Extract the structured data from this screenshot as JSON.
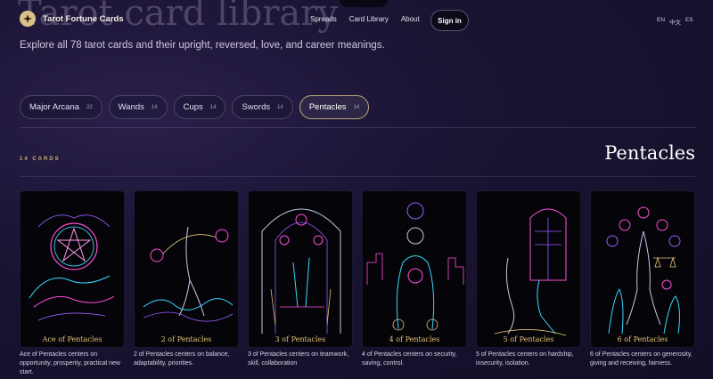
{
  "header": {
    "background_title": "Tarot card library",
    "brand": "Tarot Fortune Cards",
    "nav": [
      "Spreads",
      "Card Library",
      "About"
    ],
    "signin": "Sign in",
    "languages": [
      "EN",
      "中文",
      "ES"
    ]
  },
  "subtitle": "Explore all 78 tarot cards and their upright, reversed, love, and career meanings.",
  "tabs": [
    {
      "label": "Major Arcana",
      "count": "22",
      "active": false
    },
    {
      "label": "Wands",
      "count": "14",
      "active": false
    },
    {
      "label": "Cups",
      "count": "14",
      "active": false
    },
    {
      "label": "Swords",
      "count": "14",
      "active": false
    },
    {
      "label": "Pentacles",
      "count": "14",
      "active": true
    }
  ],
  "section": {
    "count_label": "14 CARDS",
    "title": "Pentacles"
  },
  "cards": [
    {
      "name": "Ace of Pentacles",
      "description": "Ace of Pentacles centers on opportunity, prosperity, practical new start."
    },
    {
      "name": "2 of Pentacles",
      "description": "2 of Pentacles centers on balance, adaptability, priorities."
    },
    {
      "name": "3 of Pentacles",
      "description": "3 of Pentacles centers on teamwork, skill, collaboration"
    },
    {
      "name": "4 of Pentacles",
      "description": "4 of Pentacles centers on security, saving, control."
    },
    {
      "name": "5 of Pentacles",
      "description": "5 of Pentacles centers on hardship, insecurity, isolation."
    },
    {
      "name": "6 of Pentacles",
      "description": "6 of Pentacles centers on generosity, giving and receiving, fairness."
    }
  ],
  "colors": {
    "accent_gold": "#c9b16c",
    "card_title": "#e2c47c",
    "neon_pink": "#ff4fd8",
    "neon_cyan": "#39d8ff",
    "neon_purple": "#9a5cff"
  }
}
